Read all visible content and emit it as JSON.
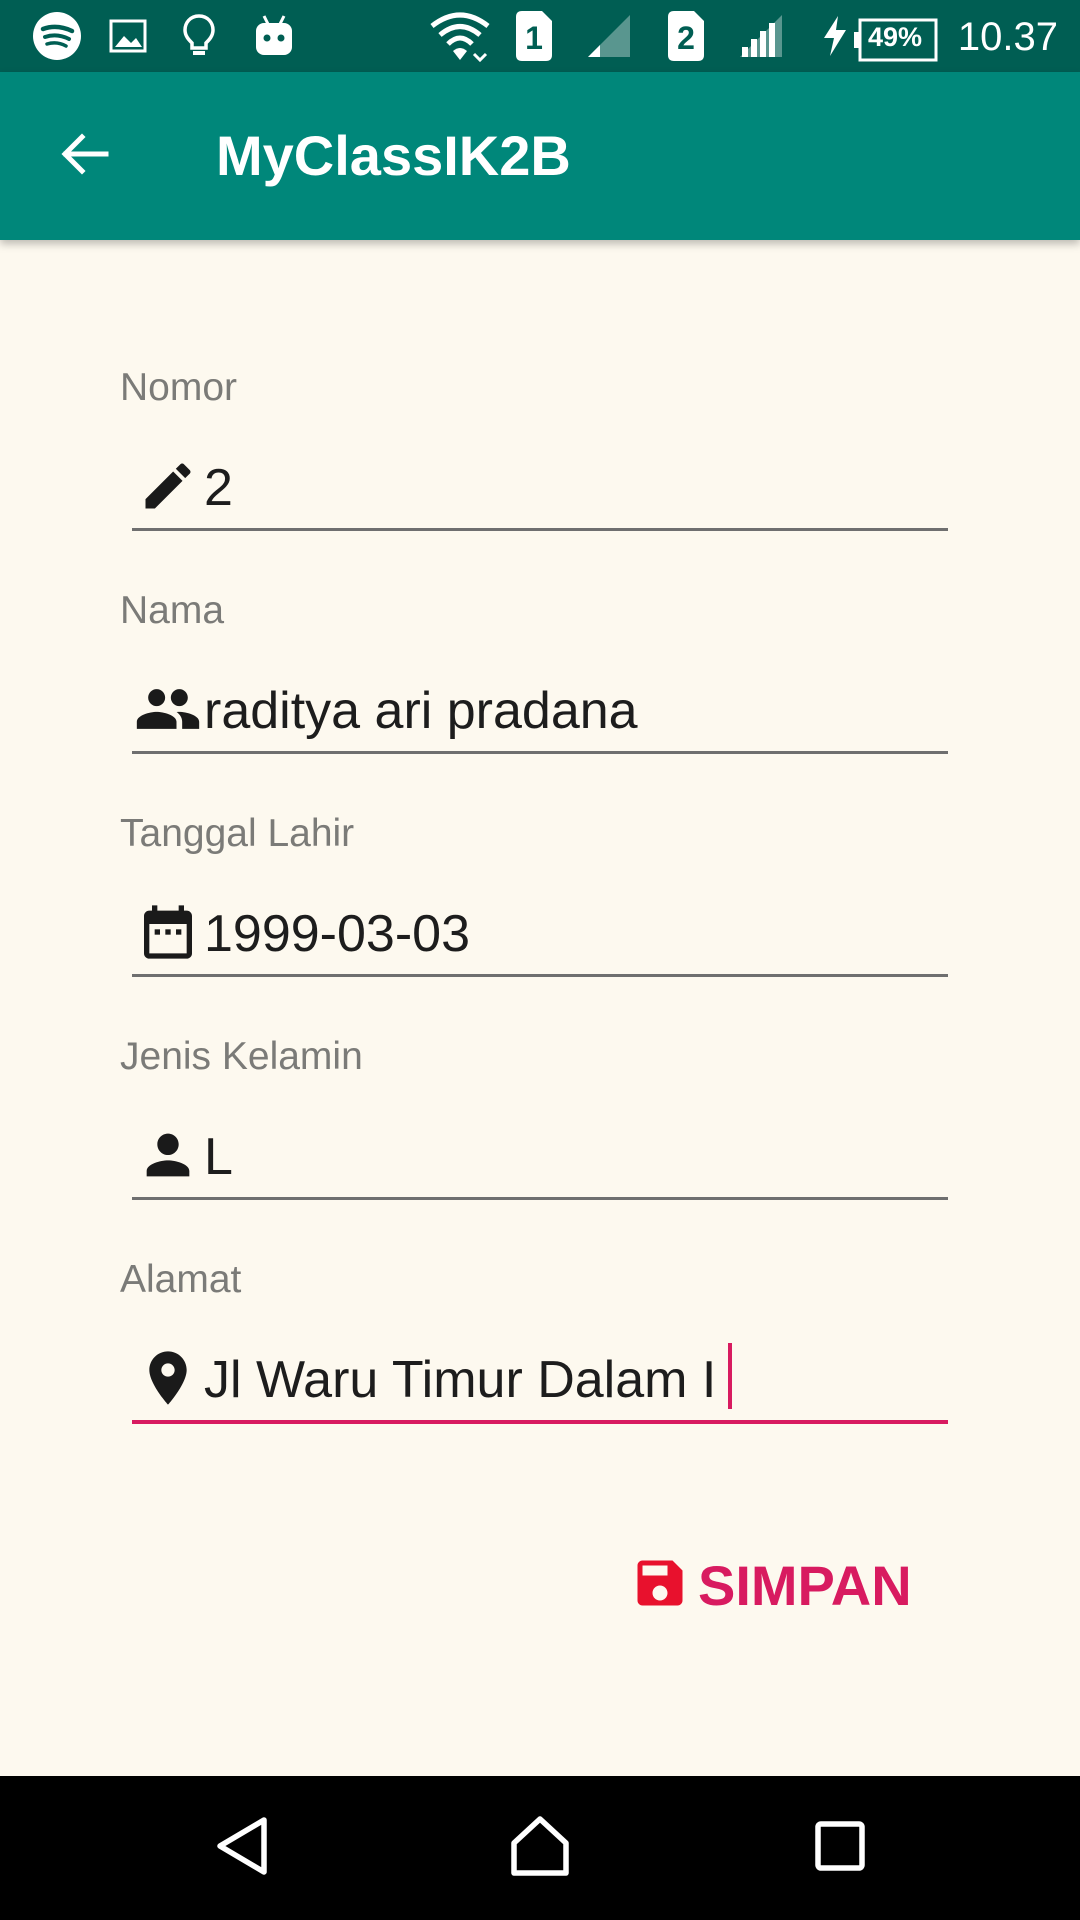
{
  "status_bar": {
    "left_icons": [
      "spotify-icon",
      "image-icon",
      "lightbulb-icon",
      "android-icon"
    ],
    "sim1_label": "1",
    "sim2_label": "2",
    "battery_percent": "49%",
    "time": "10.37"
  },
  "toolbar": {
    "back_icon": "arrow-back-icon",
    "title": "MyClassIK2B"
  },
  "form": {
    "fields": [
      {
        "label": "Nomor",
        "value": "2",
        "icon": "pencil-icon"
      },
      {
        "label": "Nama",
        "value": "raditya ari pradana",
        "icon": "people-icon"
      },
      {
        "label": "Tanggal Lahir",
        "value": "1999-03-03",
        "icon": "calendar-icon"
      },
      {
        "label": "Jenis Kelamin",
        "value": "L",
        "icon": "person-icon"
      },
      {
        "label": "Alamat",
        "value": "Jl Waru Timur Dalam I",
        "icon": "location-pin-icon"
      }
    ],
    "save_label": "SIMPAN",
    "save_icon": "floppy-disk-icon"
  },
  "colors": {
    "status_bar": "#005e53",
    "toolbar": "#00877a",
    "background": "#fdf9ef",
    "accent": "#d81b60",
    "save_icon": "#e8112d"
  },
  "nav_bar": {
    "buttons": [
      "back-triangle-icon",
      "home-icon",
      "recents-icon"
    ]
  }
}
